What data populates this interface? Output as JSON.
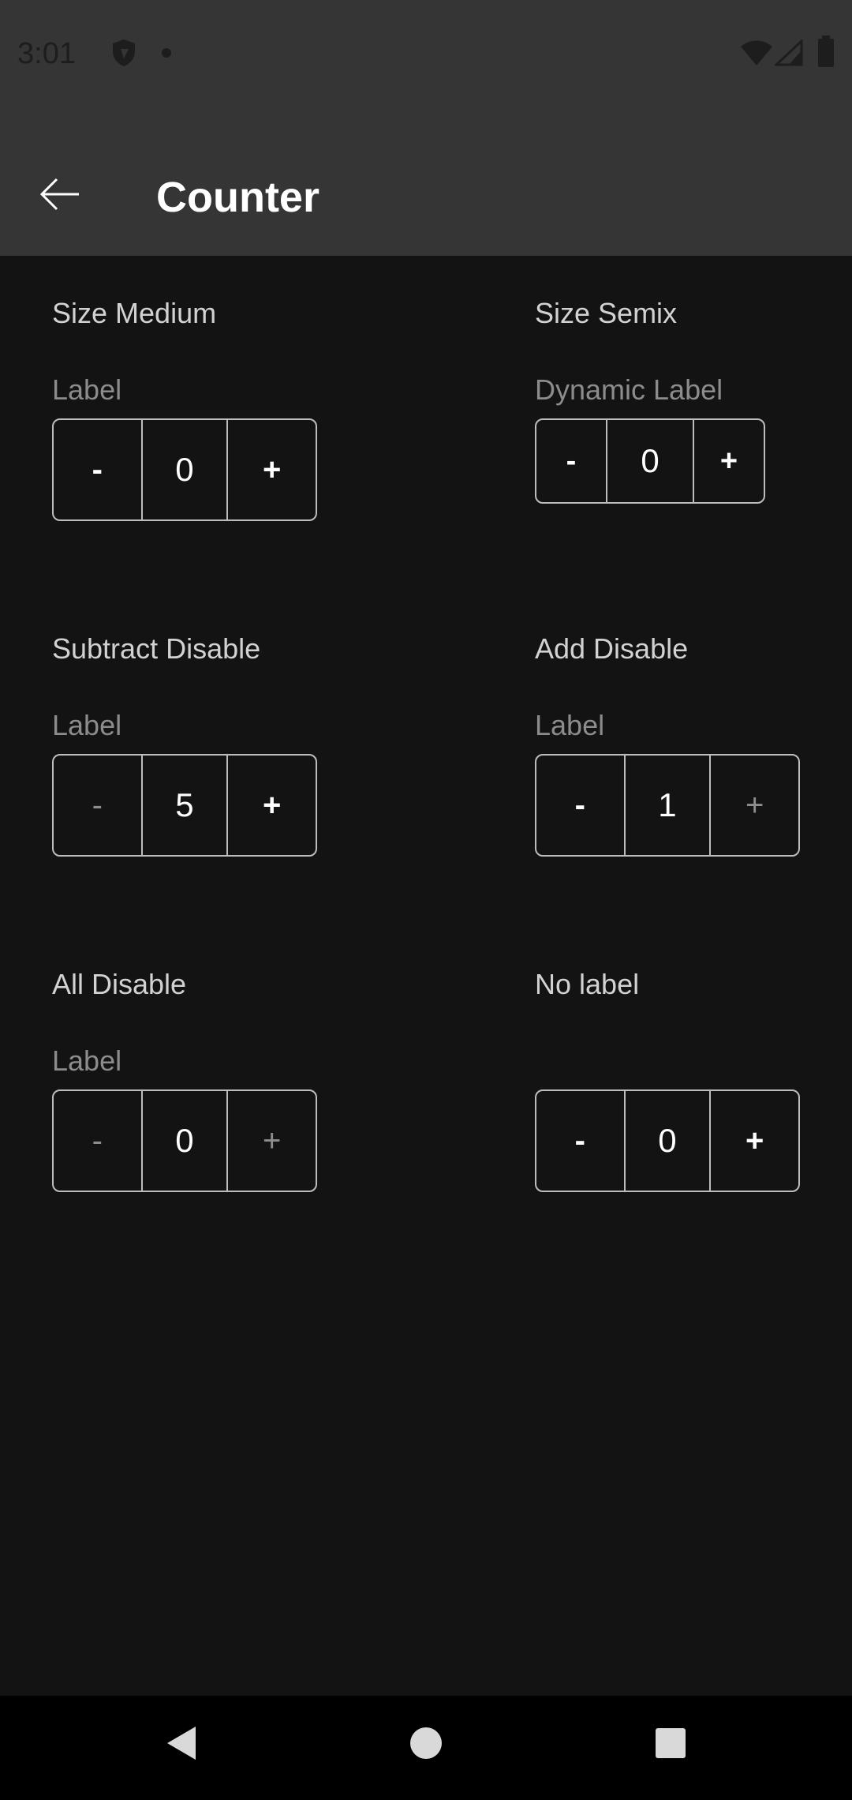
{
  "status_bar": {
    "time": "3:01",
    "icons": [
      "shield-icon",
      "notification-dot-icon",
      "wifi-icon",
      "signal-icon",
      "battery-icon"
    ]
  },
  "app_bar": {
    "title": "Counter",
    "back_icon": "arrow-left-icon"
  },
  "counters": [
    {
      "section": "Size Medium",
      "label": "Label",
      "value": "0",
      "minus": "-",
      "plus": "+"
    },
    {
      "section": "Size Semix",
      "label": "Dynamic Label",
      "value": "0",
      "minus": "-",
      "plus": "+"
    },
    {
      "section": "Subtract Disable",
      "label": "Label",
      "value": "5",
      "minus": "-",
      "plus": "+"
    },
    {
      "section": "Add Disable",
      "label": "Label",
      "value": "1",
      "minus": "-",
      "plus": "+"
    },
    {
      "section": "All Disable",
      "label": "Label",
      "value": "0",
      "minus": "-",
      "plus": "+"
    },
    {
      "section": "No label",
      "label": "",
      "value": "0",
      "minus": "-",
      "plus": "+"
    }
  ],
  "nav_bar": {
    "icons": [
      "back-triangle-icon",
      "home-circle-icon",
      "recents-square-icon"
    ]
  },
  "colors": {
    "background": "#131313",
    "bar": "#353535",
    "text_primary": "#ffffff",
    "text_secondary": "#d2d2d2",
    "text_label": "#8c8c8c",
    "border": "#bdbdbd",
    "disabled": "#8d8d8d"
  }
}
